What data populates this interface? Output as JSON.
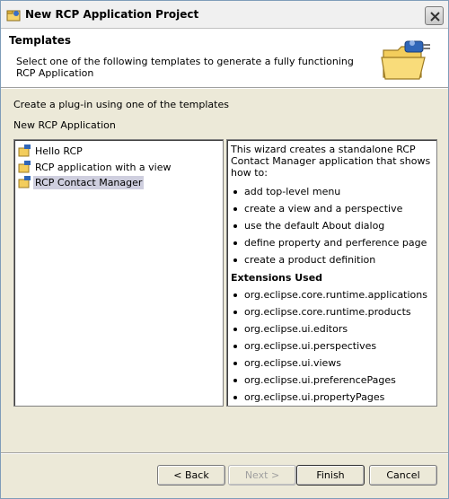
{
  "window": {
    "title": "New RCP Application Project"
  },
  "header": {
    "title": "Templates",
    "description": "Select one of the following templates to generate a fully functioning RCP Application"
  },
  "labels": {
    "create_prompt": "Create a plug-in using one of the templates",
    "category": "New RCP Application"
  },
  "templates": [
    {
      "label": "Hello RCP",
      "icon": "template-icon",
      "selected": false
    },
    {
      "label": "RCP application with a view",
      "icon": "template-icon",
      "selected": false
    },
    {
      "label": "RCP Contact Manager",
      "icon": "template-icon",
      "selected": true
    }
  ],
  "description_pane": {
    "intro": "This wizard creates a standalone RCP Contact Manager application that shows how to:",
    "features": [
      "add top-level menu",
      "create a view and a perspective",
      "use the default About dialog",
      "define property and perference page",
      "create a product definition"
    ],
    "extensions_heading": "Extensions Used",
    "extensions": [
      "org.eclipse.core.runtime.applications",
      "org.eclipse.core.runtime.products",
      "org.eclipse.ui.editors",
      "org.eclipse.ui.perspectives",
      "org.eclipse.ui.views",
      "org.eclipse.ui.preferencePages",
      "org.eclipse.ui.propertyPages"
    ]
  },
  "buttons": {
    "back": "< Back",
    "next": "Next >",
    "finish": "Finish",
    "cancel": "Cancel"
  }
}
